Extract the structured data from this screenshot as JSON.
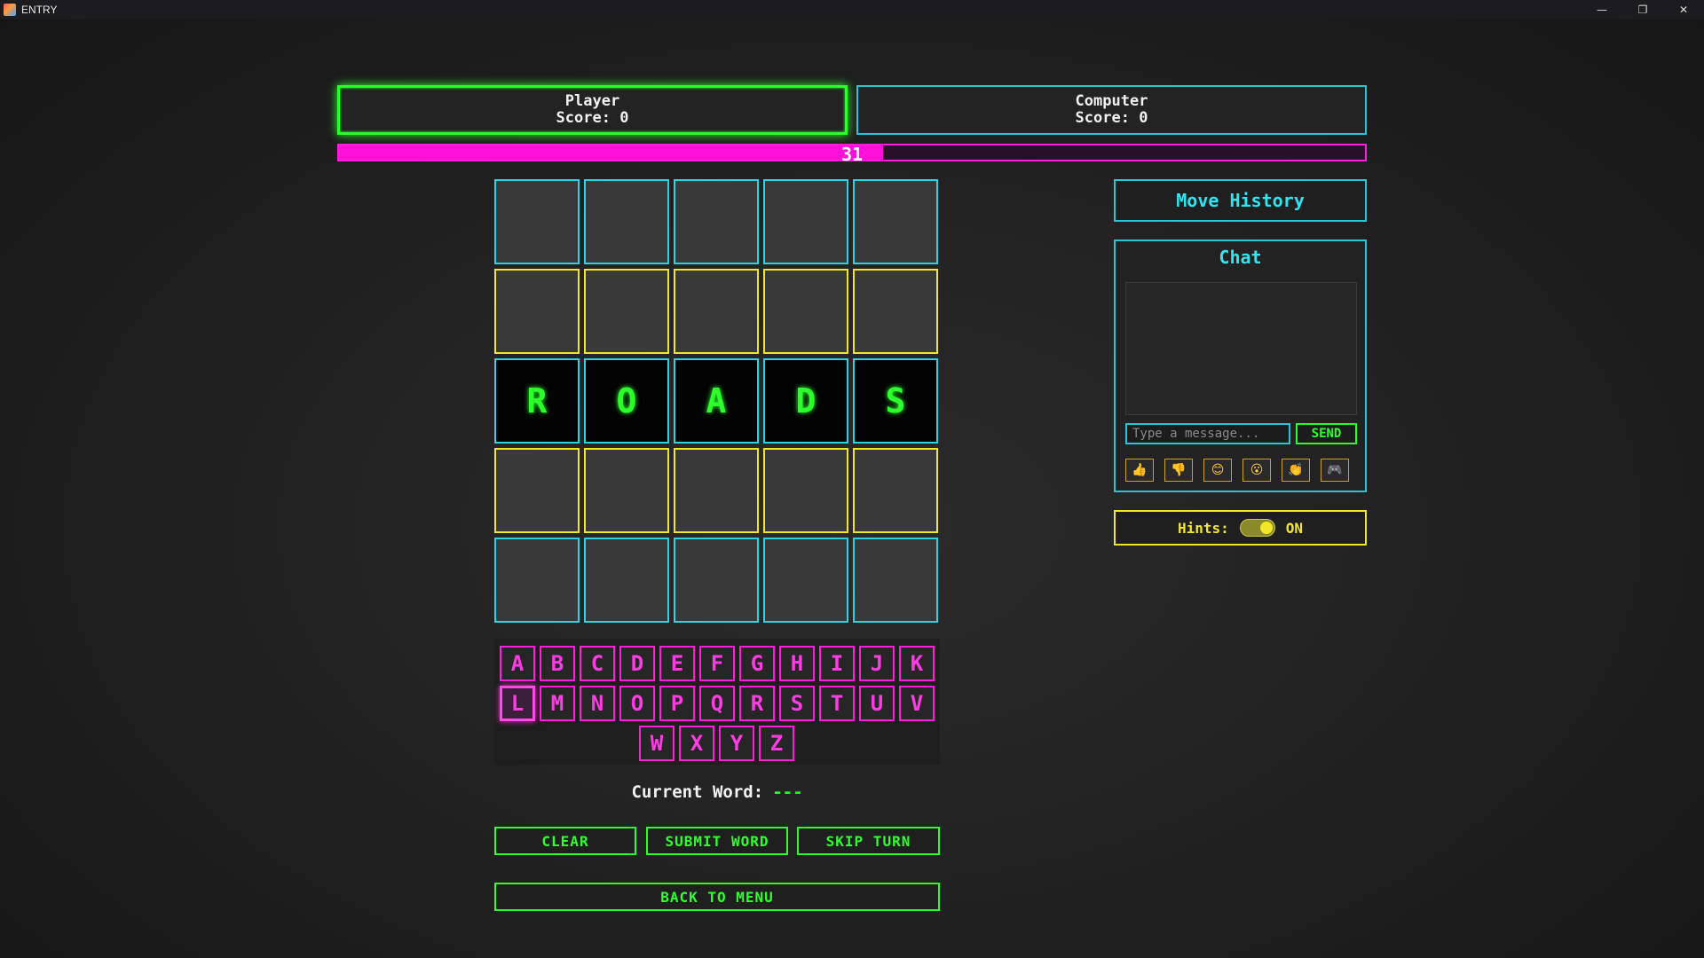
{
  "window": {
    "title": "ENTRY"
  },
  "player": {
    "name": "Player",
    "score_text": "Score: 0"
  },
  "computer": {
    "name": "Computer",
    "score_text": "Score: 0"
  },
  "timer": {
    "label": "31",
    "fraction": 0.53,
    "color": "#ff10d8"
  },
  "board": {
    "rows": [
      {
        "style": "cyan",
        "letters": [
          "",
          "",
          "",
          "",
          ""
        ]
      },
      {
        "style": "yellow",
        "letters": [
          "",
          "",
          "",
          "",
          ""
        ]
      },
      {
        "style": "filled",
        "letters": [
          "R",
          "O",
          "A",
          "D",
          "S"
        ]
      },
      {
        "style": "yellow",
        "letters": [
          "",
          "",
          "",
          "",
          ""
        ]
      },
      {
        "style": "cyan",
        "letters": [
          "",
          "",
          "",
          "",
          ""
        ]
      }
    ]
  },
  "keyboard": {
    "row1": [
      "A",
      "B",
      "C",
      "D",
      "E",
      "F",
      "G",
      "H",
      "I",
      "J",
      "K"
    ],
    "row2": [
      "L",
      "M",
      "N",
      "O",
      "P",
      "Q",
      "R",
      "S",
      "T",
      "U",
      "V"
    ],
    "row3": [
      "W",
      "X",
      "Y",
      "Z"
    ],
    "selected": "L"
  },
  "current_word": {
    "label": "Current Word:",
    "value": "---"
  },
  "buttons": {
    "clear": "CLEAR",
    "submit": "SUBMIT WORD",
    "skip": "SKIP TURN",
    "back": "BACK TO MENU"
  },
  "sidebar": {
    "history": "Move History",
    "chat": {
      "title": "Chat",
      "placeholder": "Type a message...",
      "send": "SEND",
      "emojis": [
        "👍",
        "👎",
        "😊",
        "😮",
        "👏",
        "🎮"
      ]
    },
    "hints": {
      "label": "Hints:",
      "state": "ON"
    }
  },
  "colors": {
    "green": "#2cff2c",
    "cyan": "#27c6d6",
    "magenta": "#ff1edc",
    "yellow": "#f2e62a"
  }
}
